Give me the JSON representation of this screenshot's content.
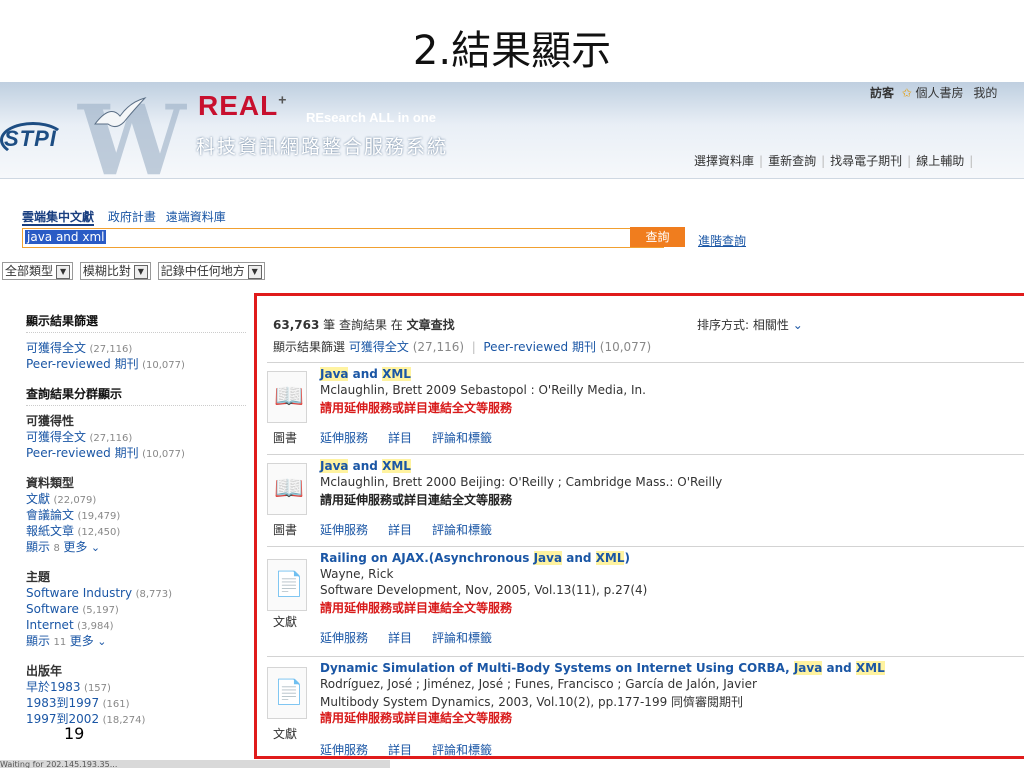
{
  "slide_title": "2.結果顯示",
  "header": {
    "logo_stpi": "STPI",
    "logo_real": "REAL",
    "logo_plus": "+",
    "logo_tagline": "REsearch ALL in one",
    "system_name": "科技資訊網路整合服務系統",
    "user_label": "訪客",
    "user_links": [
      "個人書房",
      "我的"
    ],
    "nav": [
      "選擇資料庫",
      "重新查詢",
      "找尋電子期刊",
      "線上輔助"
    ]
  },
  "search": {
    "tabs": [
      "雲端集中文獻",
      "政府計畫",
      "遠端資料庫"
    ],
    "query": "java and xml",
    "button": "查詢",
    "advanced": "進階查詢",
    "filters": [
      "全部類型",
      "模糊比對",
      "記錄中任何地方"
    ]
  },
  "sidebar": {
    "filter_title": "顯示結果篩選",
    "filter_items": [
      {
        "label": "可獲得全文",
        "count": "(27,116)"
      },
      {
        "label": "Peer-reviewed 期刊",
        "count": "(10,077)"
      }
    ],
    "cluster_title": "查詢結果分群顯示",
    "availability": {
      "title": "可獲得性",
      "items": [
        {
          "label": "可獲得全文",
          "count": "(27,116)"
        },
        {
          "label": "Peer-reviewed 期刊",
          "count": "(10,077)"
        }
      ]
    },
    "types": {
      "title": "資料類型",
      "items": [
        {
          "label": "文獻",
          "count": "(22,079)"
        },
        {
          "label": "會議論文",
          "count": "(19,479)"
        },
        {
          "label": "報紙文章",
          "count": "(12,450)"
        }
      ],
      "more_prefix": "顯示",
      "more_count": "8",
      "more": "更多"
    },
    "subjects": {
      "title": "主題",
      "items": [
        {
          "label": "Software Industry",
          "count": "(8,773)"
        },
        {
          "label": "Software",
          "count": "(5,197)"
        },
        {
          "label": "Internet",
          "count": "(3,984)"
        }
      ],
      "more_prefix": "顯示",
      "more_count": "11",
      "more": "更多"
    },
    "years": {
      "title": "出版年",
      "items": [
        {
          "label": "早於1983",
          "count": "(157)"
        },
        {
          "label": "1983到1997",
          "count": "(161)"
        },
        {
          "label": "1997到2002",
          "count": "(18,274)"
        }
      ]
    }
  },
  "results": {
    "count": "63,763",
    "count_text": "筆 查詢結果 在",
    "scope": "文章查找",
    "sort_label": "排序方式:",
    "sort_value": "相關性",
    "subfilter_label": "顯示結果篩選",
    "subfilters": [
      {
        "label": "可獲得全文",
        "count": "(27,116)"
      },
      {
        "label": "Peer-reviewed 期刊",
        "count": "(10,077)"
      }
    ],
    "actions": [
      "延伸服務",
      "詳目",
      "評論和標籤"
    ],
    "items": [
      {
        "type": "圖書",
        "title_parts": [
          "Java",
          " and ",
          "XML"
        ],
        "meta": [
          "Mclaughlin, Brett 2009 Sebastopol : O'Reilly Media, In."
        ],
        "service": "請用延伸服務或詳目連結全文等服務"
      },
      {
        "type": "圖書",
        "title_parts": [
          "Java",
          " and ",
          "XML"
        ],
        "meta": [
          "Mclaughlin, Brett 2000 Beijing: O'Reilly ; Cambridge Mass.: O'Reilly"
        ],
        "service": "請用延伸服務或詳目連結全文等服務"
      },
      {
        "type": "文獻",
        "title_parts": [
          "Railing on AJAX.(Asynchronous ",
          "Java",
          " and ",
          "XML",
          ")"
        ],
        "meta": [
          "Wayne, Rick",
          "Software Development, Nov, 2005, Vol.13(11), p.27(4)"
        ],
        "service": "請用延伸服務或詳目連結全文等服務"
      },
      {
        "type": "文獻",
        "title_parts": [
          "Dynamic Simulation of Multi-Body Systems on Internet Using CORBA, ",
          "Java",
          " and ",
          "XML"
        ],
        "meta": [
          "Rodríguez, José ; Jiménez, José ; Funes, Francisco ; García de Jalón, Javier",
          "Multibody System Dynamics, 2003, Vol.10(2), pp.177-199 同儕審閱期刊"
        ],
        "service": "請用延伸服務或詳目連結全文等服務"
      }
    ]
  },
  "page_number": "19",
  "status_text": "Waiting for 202.145.193.35..."
}
